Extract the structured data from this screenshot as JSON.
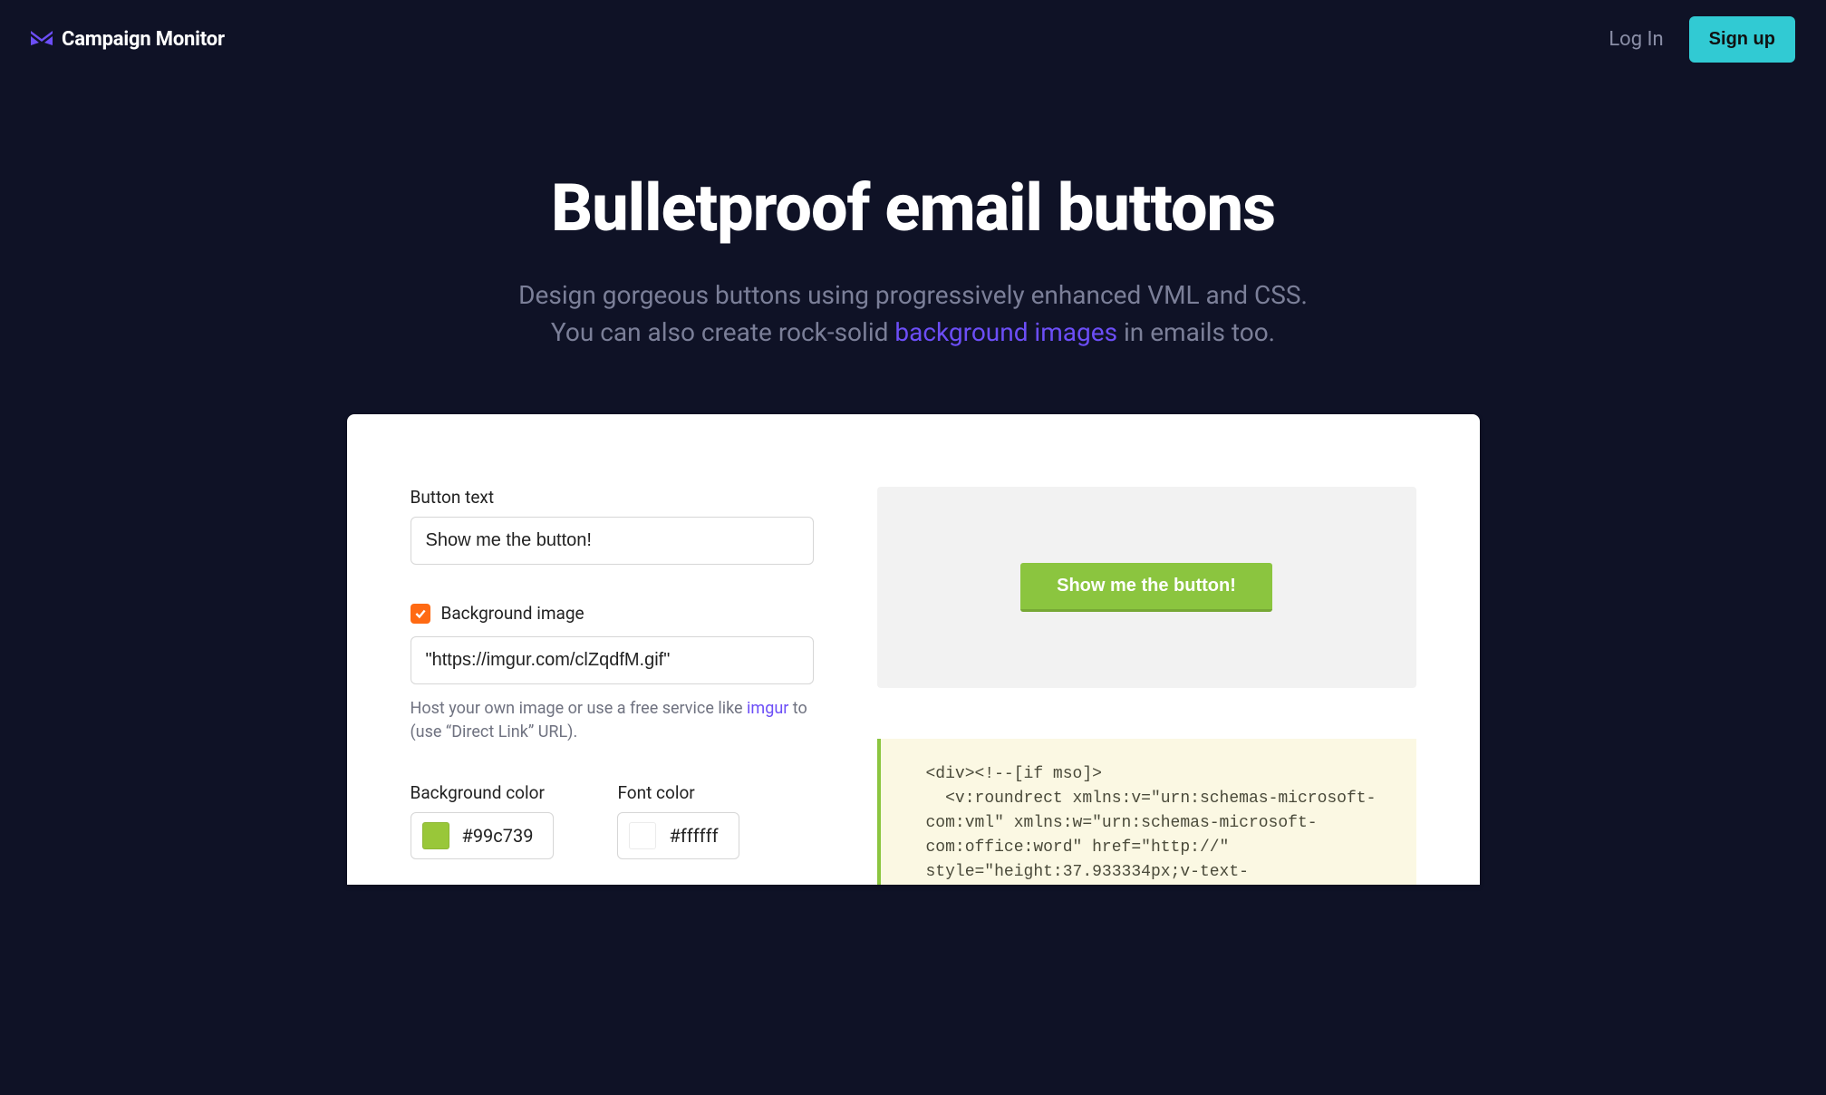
{
  "header": {
    "brand_name": "Campaign Monitor",
    "login_label": "Log In",
    "signup_label": "Sign up"
  },
  "hero": {
    "title": "Bulletproof email buttons",
    "line1": "Design gorgeous buttons using progressively enhanced VML and CSS.",
    "line2_before": "You can also create rock-solid ",
    "line2_link": "background images",
    "line2_after": " in emails too."
  },
  "form": {
    "button_text_label": "Button text",
    "button_text_value": "Show me the button!",
    "bg_image_label": "Background image",
    "bg_image_value": "\"https://imgur.com/clZqdfM.gif\"",
    "bg_image_hint_before": "Host your own image or use a free service like ",
    "bg_image_hint_link": "imgur",
    "bg_image_hint_after": " to (use “Direct Link” URL).",
    "bg_color_label": "Background color",
    "bg_color_value": "#99c739",
    "font_color_label": "Font color",
    "font_color_value": "#ffffff"
  },
  "preview": {
    "button_label": "Show me the button!",
    "button_bg": "#8bc53f",
    "button_fg": "#ffffff"
  },
  "code": {
    "snippet": "<div><!--[if mso]>\n  <v:roundrect xmlns:v=\"urn:schemas-microsoft-com:vml\" xmlns:w=\"urn:schemas-microsoft-com:office:word\" href=\"http://\" style=\"height:37.933334px;v-text-"
  }
}
